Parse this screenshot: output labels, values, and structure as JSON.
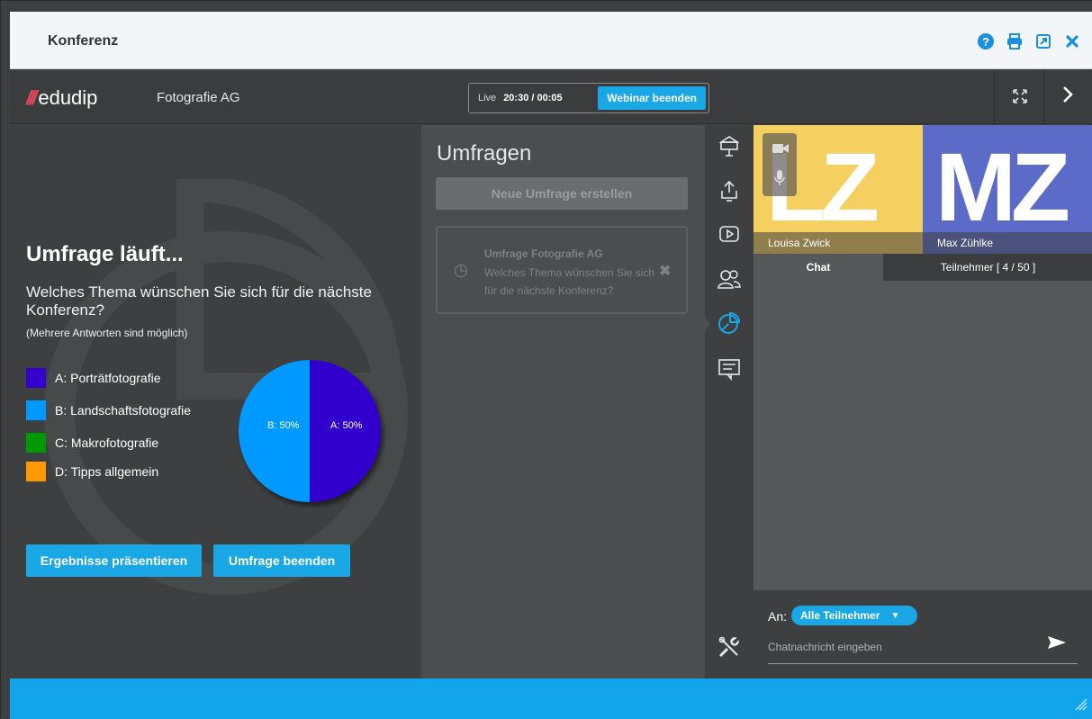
{
  "window": {
    "title": "Konferenz",
    "icons": [
      "help-icon",
      "print-icon",
      "popout-icon",
      "close-icon"
    ]
  },
  "header": {
    "logo_text": "edudip",
    "company": "Fotografie AG",
    "live_label": "Live",
    "live_time": "20:30 / 00:05",
    "end_webinar_label": "Webinar beenden"
  },
  "poll": {
    "heading": "Umfrage läuft...",
    "question": "Welches Thema wünschen Sie sich für die nächste Konferenz?",
    "hint": "(Mehrere Antworten sind möglich)",
    "present_label": "Ergebnisse präsentieren",
    "end_label": "Umfrage beenden"
  },
  "chart_data": {
    "type": "pie",
    "categories": [
      "A: Porträtfotografie",
      "B: Landschaftsfotografie",
      "C: Makrofotografie",
      "D: Tipps allgemein"
    ],
    "values": [
      50,
      50,
      0,
      0
    ],
    "colors": [
      "#3300cc",
      "#0099ff",
      "#009900",
      "#ff9900"
    ],
    "slice_labels": [
      "A: 50%",
      "B: 50%"
    ]
  },
  "surveys": {
    "title": "Umfragen",
    "new_label": "Neue Umfrage erstellen",
    "card": {
      "title": "Umfrage Fotografie AG",
      "text": "Welches Thema wünschen Sie sich für die nächste Konferenz?"
    }
  },
  "participants_video": [
    {
      "initials": "LZ",
      "name": "Louisa Zwick",
      "color": "#f5d061"
    },
    {
      "initials": "MZ",
      "name": "Max Zühlke",
      "color": "#5b6bc7"
    }
  ],
  "chat": {
    "tab_chat": "Chat",
    "tab_participants": "Teilnehmer [ 4 / 50 ]",
    "to_label": "An:",
    "recipient": "Alle Teilnehmer",
    "placeholder": "Chatnachricht eingeben"
  },
  "sidebar_icons": [
    "presentation-icon",
    "upload-icon",
    "video-play-icon",
    "participants-icon",
    "poll-icon",
    "whiteboard-icon",
    "tools-icon"
  ]
}
